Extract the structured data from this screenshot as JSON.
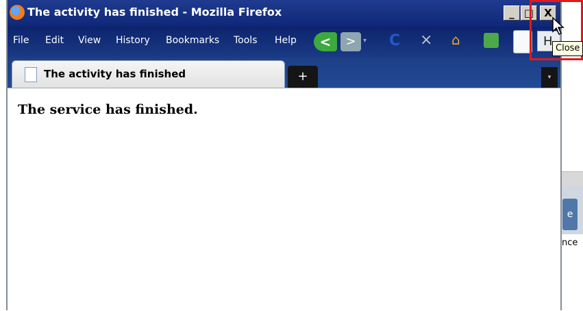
{
  "window": {
    "title": "The activity has finished - Mozilla Firefox",
    "buttons": {
      "minimize": "_",
      "maximize": "□",
      "close": "X"
    }
  },
  "menu": {
    "items": [
      "File",
      "Edit",
      "View",
      "History",
      "Bookmarks",
      "Tools",
      "Help"
    ]
  },
  "toolbar": {
    "back_glyph": "<",
    "forward_glyph": ">",
    "dropdown_glyph": "▾",
    "reload_glyph": "C",
    "stop_glyph": "×",
    "home_glyph": "⌂",
    "h_fragment": "H"
  },
  "tabs": {
    "active_label": "The activity has finished",
    "new_tab_glyph": "+",
    "list_glyph": "▾"
  },
  "page": {
    "heading": "The service has finished."
  },
  "tooltip": {
    "text": "Close"
  },
  "background": {
    "tab_fragment": "e",
    "text_fragment": "nce"
  },
  "colors": {
    "titlebar": "#1f3b8f",
    "highlight": "#e01a1a",
    "tooltip_bg": "#ffffe1"
  }
}
